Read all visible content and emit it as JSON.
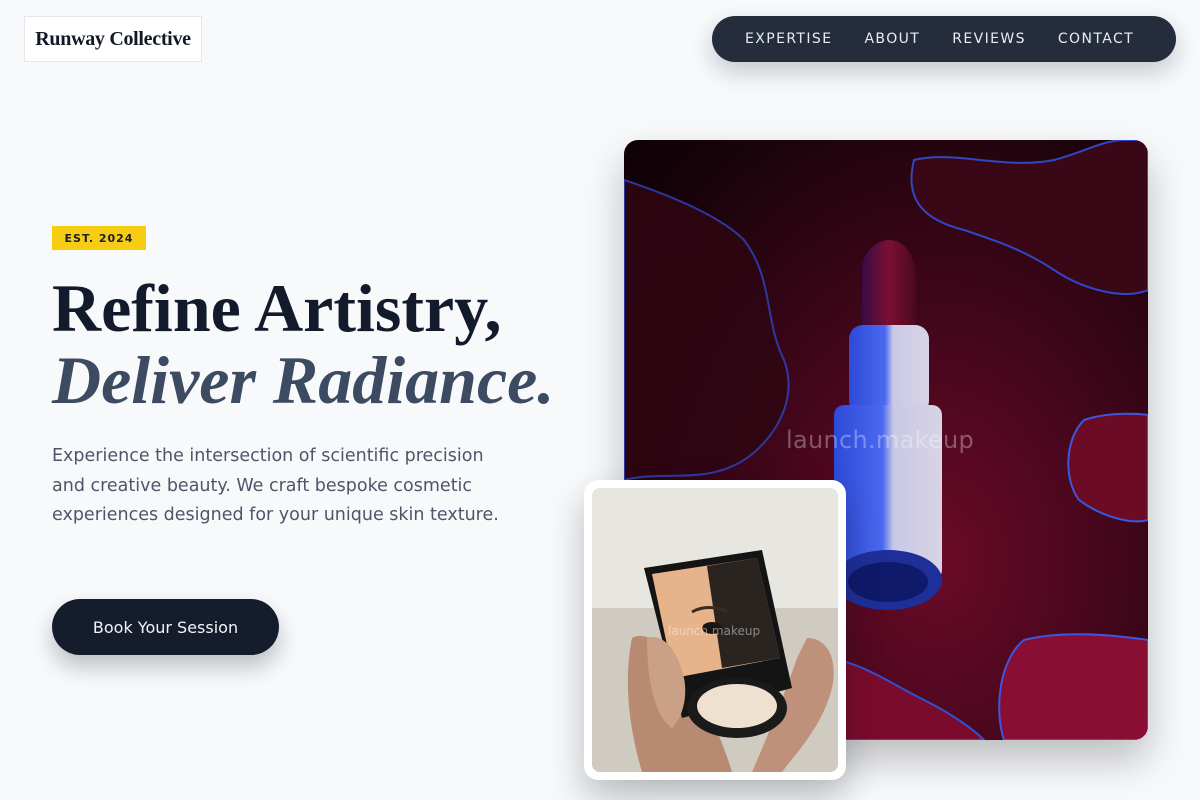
{
  "brand": {
    "name": "Runway Collective"
  },
  "nav": {
    "items": [
      {
        "label": "EXPERTISE"
      },
      {
        "label": "ABOUT"
      },
      {
        "label": "REVIEWS"
      },
      {
        "label": "CONTACT"
      }
    ]
  },
  "hero": {
    "badge": "EST. 2024",
    "headline_line1": "Refine Artistry,",
    "headline_line2": "Deliver Radiance.",
    "description": "Experience the intersection of scientific precision and creative beauty. We craft bespoke cosmetic experiences designed for your unique skin texture.",
    "cta_label": "Book Your Session"
  },
  "images": {
    "main": {
      "subject": "lipstick",
      "watermark": "launch.makeup"
    },
    "thumbnail": {
      "subject": "compact-mirror",
      "watermark": "launch.makeup"
    }
  },
  "colors": {
    "background": "#f7f9fb",
    "nav_bg": "#252d3d",
    "badge_bg": "#f7cd14",
    "cta_bg": "#151c2c",
    "headline": "#121a2b",
    "headline_italic": "#3c4a62"
  }
}
